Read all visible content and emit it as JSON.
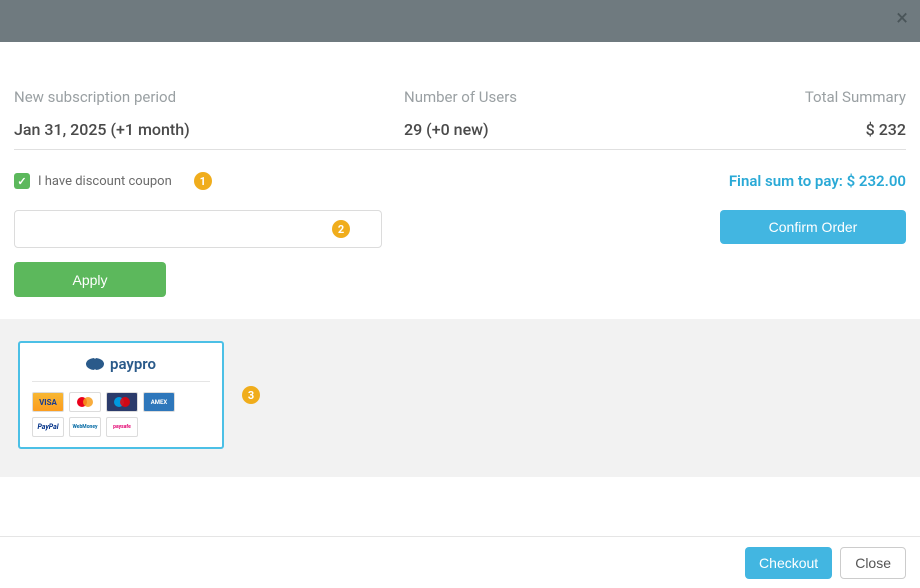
{
  "labels": {
    "period": "New subscription period",
    "users": "Number of Users",
    "total": "Total Summary"
  },
  "values": {
    "period": "Jan 31, 2025 (+1 month)",
    "users": "29 (+0 new)",
    "total": "$ 232"
  },
  "discount": {
    "label": "I have discount coupon",
    "checked": true,
    "coupon_value": ""
  },
  "final_sum": {
    "label": "Final sum to pay: ",
    "amount": "$ 232.00"
  },
  "buttons": {
    "apply": "Apply",
    "confirm": "Confirm Order",
    "checkout": "Checkout",
    "close": "Close"
  },
  "steps": {
    "one": "1",
    "two": "2",
    "three": "3"
  },
  "payment": {
    "provider": "paypro",
    "methods": [
      "VISA",
      "mastercard",
      "maestro",
      "amex",
      "PayPal",
      "WebMoney",
      "paysafe"
    ]
  }
}
